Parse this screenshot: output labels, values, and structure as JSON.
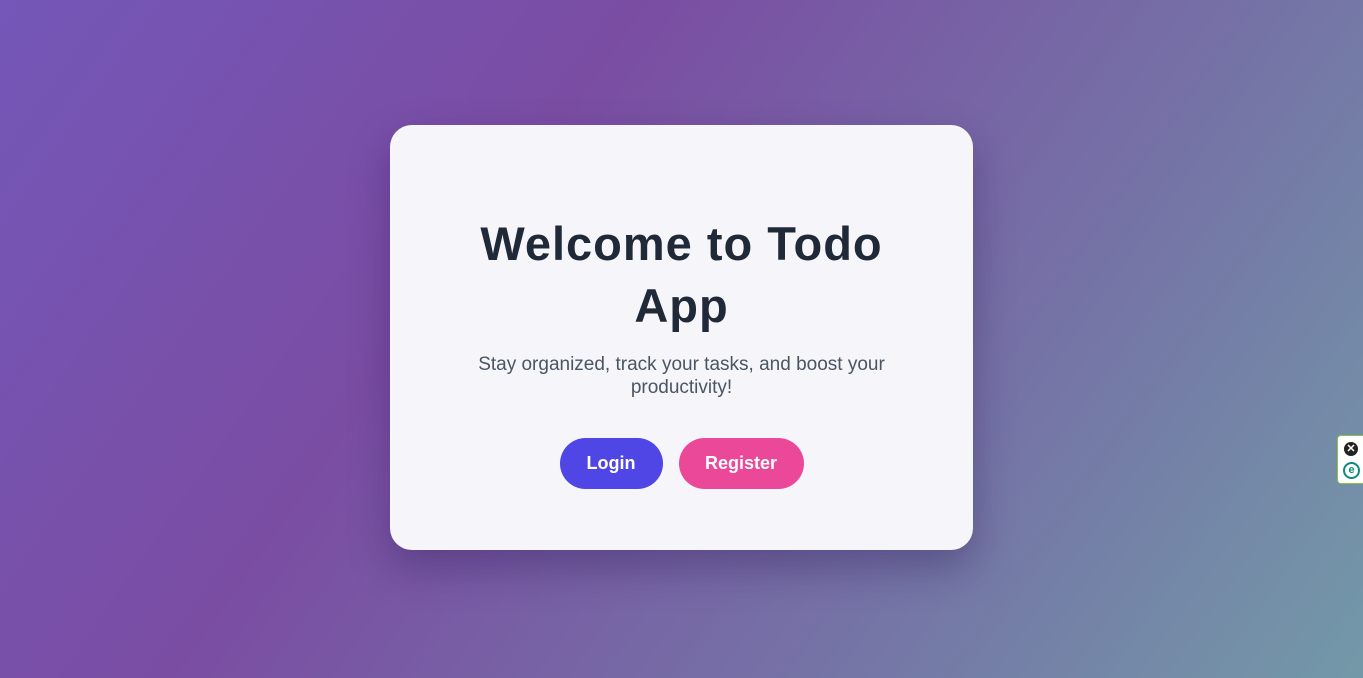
{
  "card": {
    "title": "Welcome to Todo App",
    "subtitle": "Stay organized, track your tasks, and boost your productivity!",
    "buttons": {
      "login_label": "Login",
      "register_label": "Register"
    }
  },
  "extension_widget": {
    "close_icon": "close-icon",
    "logo_icon": "extension-logo-icon",
    "close_glyph": "✕",
    "logo_glyph": "e"
  },
  "colors": {
    "login_button": "#4f46e5",
    "register_button": "#ec4899",
    "title_text": "#1f2937",
    "card_background": "#f6f5fa"
  }
}
